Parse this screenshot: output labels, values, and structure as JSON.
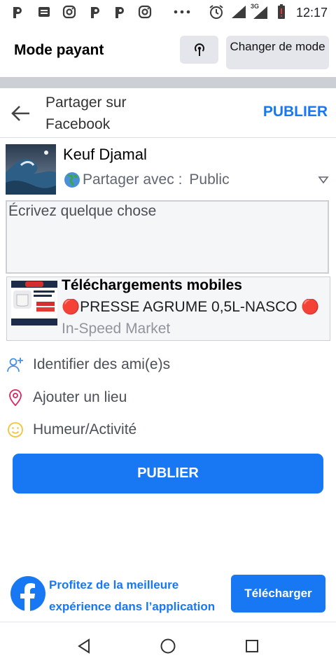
{
  "status_bar": {
    "time": "12:17",
    "network_label": "3G",
    "icons": [
      "p-app-icon",
      "messages-icon",
      "instagram-icon",
      "p-app-icon",
      "p-app-icon",
      "instagram-icon",
      "more-dots-icon",
      "alarm-icon",
      "signal-icon",
      "signal-3g-icon",
      "battery-alert-icon"
    ]
  },
  "header": {
    "title": "Mode payant",
    "change_mode_label": "Changer de mode"
  },
  "share_bar": {
    "title": "Partager sur Facebook",
    "publish_label": "PUBLIER"
  },
  "user": {
    "name": "Keuf Djamal",
    "share_with_label": "Partager avec :",
    "audience": "Public"
  },
  "composer": {
    "placeholder": "Écrivez quelque chose"
  },
  "preview": {
    "title": "Téléchargements mobiles",
    "description": "🔴PRESSE AGRUME 0,5L-NASCO 🔴",
    "site": "In-Speed Market"
  },
  "actions": [
    {
      "label": "Identifier des ami(e)s",
      "icon": "tag-friends-icon"
    },
    {
      "label": "Ajouter un lieu",
      "icon": "location-pin-icon"
    },
    {
      "label": "Humeur/Activité",
      "icon": "smiley-icon"
    }
  ],
  "publish_button": "PUBLIER",
  "promo": {
    "text": "Profitez de la meilleure expérience dans l’application",
    "download_label": "Télécharger"
  },
  "colors": {
    "accent": "#1877f2",
    "band": "#ccd0d5",
    "button_gray": "#e4e6eb"
  }
}
